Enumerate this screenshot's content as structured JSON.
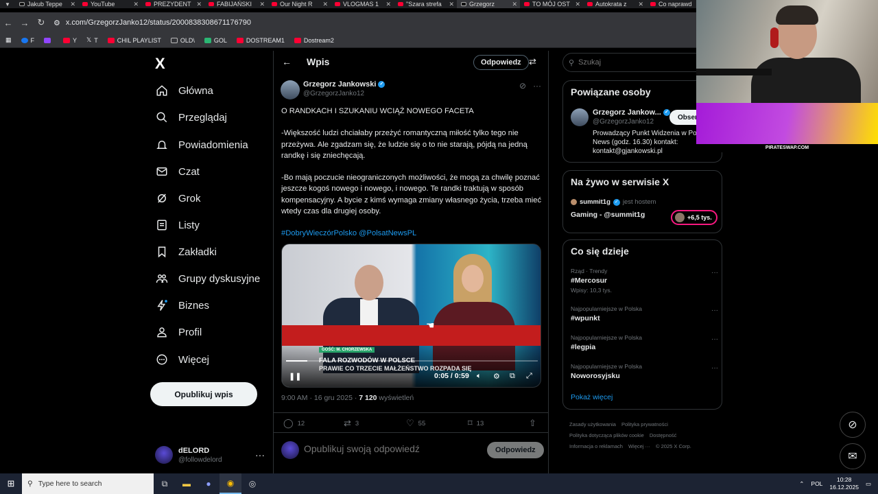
{
  "browser": {
    "tabs": [
      {
        "label": "Jakub Teppe"
      },
      {
        "label": "YouTube"
      },
      {
        "label": "PREZYDENT"
      },
      {
        "label": "FABIJAŃSKI"
      },
      {
        "label": "Our Night R"
      },
      {
        "label": "VLOGMAS 1"
      },
      {
        "label": "\"Szara strefa"
      },
      {
        "label": "Grzegorz"
      },
      {
        "label": "TO MÓJ OST"
      },
      {
        "label": "Autokrata z"
      },
      {
        "label": "Co naprawd"
      }
    ],
    "url": "x.com/GrzegorzJanko12/status/2000838308671176790",
    "bookmarks": [
      {
        "label": "F"
      },
      {
        "label": ""
      },
      {
        "label": "Y"
      },
      {
        "label": "T"
      },
      {
        "label": "CHIL PLAYLIST"
      },
      {
        "label": "OLD\\"
      },
      {
        "label": "GOL"
      },
      {
        "label": "DOSTREAM1"
      },
      {
        "label": "Dostream2"
      }
    ]
  },
  "nav": {
    "logo": "X",
    "items": [
      {
        "label": "Główna"
      },
      {
        "label": "Przeglądaj"
      },
      {
        "label": "Powiadomienia"
      },
      {
        "label": "Czat"
      },
      {
        "label": "Grok"
      },
      {
        "label": "Listy"
      },
      {
        "label": "Zakładki"
      },
      {
        "label": "Grupy dyskusyjne"
      },
      {
        "label": "Biznes"
      },
      {
        "label": "Profil"
      },
      {
        "label": "Więcej"
      }
    ],
    "post_button": "Opublikuj wpis",
    "account": {
      "name": "dELORD",
      "handle": "@followdelord"
    }
  },
  "post": {
    "header_title": "Wpis",
    "header_reply": "Odpowiedz",
    "author_name": "Grzegorz Jankowski",
    "author_handle": "@GrzegorzJanko12",
    "text": [
      "O RANDKACH I SZUKANIU WCIĄŻ NOWEGO FACETA",
      "-Większość ludzi chciałaby przeżyć romantyczną miłość tylko tego nie przeżywa. Ale zgadzam się, że ludzie się o to nie starają, pójdą na jedną randkę i się zniechęcają.",
      "-Bo mają poczucie nieograniczonych możliwości, że mogą za chwilę poznać jeszcze kogoś nowego i nowego, i nowego. Te randki traktują w sposób kompensacyjny. A bycie z kimś wymaga zmiany własnego życia, trzeba mieć wtedy czas dla drugiej osoby."
    ],
    "hashtags": "#DobryWieczórPolsko @PolsatNewsPL",
    "video": {
      "guest_label": "GOŚĆ: M. CHORZEWSKA",
      "headline1": "FALA ROZWODÓW W POLSCE",
      "headline2": "PRAWIE CO TRZECIE MAŁŻEŃSTWO ROZPADA SIĘ",
      "time": "0:05 / 0:59",
      "progress": 0.085
    },
    "meta_time": "9:00 AM · 16 gru 2025 · ",
    "views": "7 120",
    "views_label": " wyświetleń",
    "replies": "12",
    "reposts": "3",
    "likes": "55",
    "bookmarks": "13",
    "reply_placeholder": "Opublikuj swoją odpowiedź",
    "reply_button": "Odpowiedz"
  },
  "sidebar": {
    "search_placeholder": "Szukaj",
    "related": {
      "title": "Powiązane osoby",
      "name": "Grzegorz Jankow...",
      "handle": "@GrzegorzJanko12",
      "follow": "Obserwuj",
      "bio": "Prowadzący Punkt Widzenia w Polsat News (godz. 16.30) kontakt: kontakt@gjankowski.pl"
    },
    "live": {
      "title": "Na żywo w serwisie X",
      "host": "summit1g",
      "host_suffix": "jest hostem",
      "stream_title": "Gaming - @summit1g",
      "count": "+6,5 tys."
    },
    "trends": {
      "title": "Co się dzieje",
      "items": [
        {
          "context": "Rząd · Trendy",
          "name": "#Mercosur",
          "count": "Wpisy: 10,3 tys."
        },
        {
          "context": "Najpopularniejsze w Polska",
          "name": "#wpunkt",
          "count": ""
        },
        {
          "context": "Najpopularniejsze w Polska",
          "name": "#legpia",
          "count": ""
        },
        {
          "context": "Najpopularniejsze w Polska",
          "name": "Noworosyjsku",
          "count": ""
        }
      ],
      "show_more": "Pokaż więcej"
    },
    "footer": [
      "Zasady użytkowania",
      "Polityka prywatności",
      "Polityka dotycząca plików cookie",
      "Dostępność",
      "Informacja o reklamach",
      "Więcej ···",
      "© 2025 X Corp."
    ]
  },
  "overlay": {
    "banner_text": "PIRATESWAP.COM"
  },
  "taskbar": {
    "search_placeholder": "Type here to search",
    "lang": "POL",
    "time": "10:28",
    "date": "16.12.2025"
  },
  "colors": {
    "accent": "#1d9bf0",
    "background": "#000000",
    "border": "#2f3336",
    "live_ring": "#f91880"
  }
}
